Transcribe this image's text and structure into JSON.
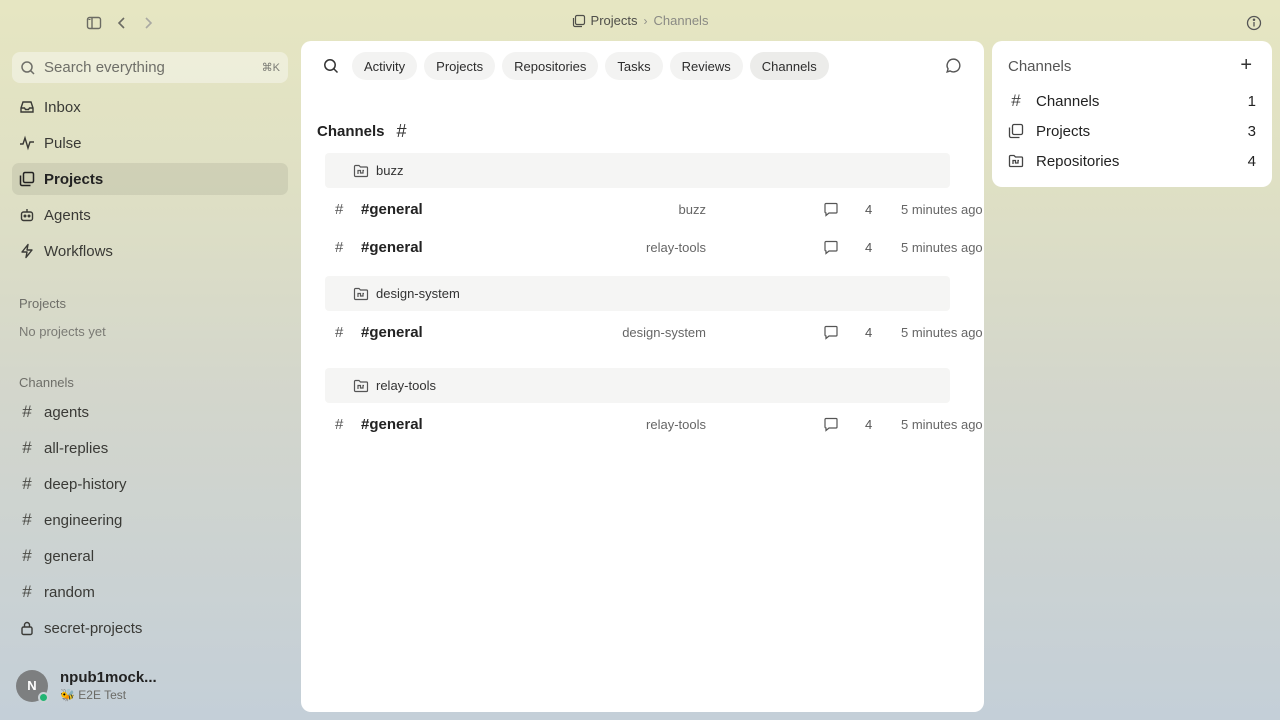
{
  "topbar": {
    "breadcrumb": [
      "Projects",
      "Channels"
    ],
    "separator": "›"
  },
  "search": {
    "placeholder": "Search everything",
    "shortcut": "⌘K"
  },
  "nav": [
    {
      "label": "Inbox",
      "icon": "inbox-icon",
      "active": false
    },
    {
      "label": "Pulse",
      "icon": "pulse-icon",
      "active": false
    },
    {
      "label": "Projects",
      "icon": "projects-icon",
      "active": true
    },
    {
      "label": "Agents",
      "icon": "agents-icon",
      "active": false
    },
    {
      "label": "Workflows",
      "icon": "workflows-icon",
      "active": false
    }
  ],
  "sidebar_projects": {
    "title": "Projects",
    "empty": "No projects yet"
  },
  "sidebar_channels": {
    "title": "Channels",
    "items": [
      {
        "label": "agents",
        "icon": "#"
      },
      {
        "label": "all-replies",
        "icon": "#"
      },
      {
        "label": "deep-history",
        "icon": "#"
      },
      {
        "label": "engineering",
        "icon": "#"
      },
      {
        "label": "general",
        "icon": "#"
      },
      {
        "label": "random",
        "icon": "#"
      },
      {
        "label": "secret-projects",
        "icon": "lock-icon"
      }
    ]
  },
  "user": {
    "initial": "N",
    "name": "npub1mock...",
    "subtitle": "🐝 E2E Test",
    "status_color": "#22b573"
  },
  "tabs": [
    "Activity",
    "Projects",
    "Repositories",
    "Tasks",
    "Reviews",
    "Channels"
  ],
  "active_tab": "Channels",
  "page": {
    "title": "Channels",
    "title_icon": "#"
  },
  "groups": [
    {
      "name": "buzz",
      "rows": [
        {
          "name": "#general",
          "project": "buzz",
          "messages": "4",
          "time": "5 minutes ago"
        },
        {
          "name": "#general",
          "project": "relay-tools",
          "messages": "4",
          "time": "5 minutes ago"
        }
      ]
    },
    {
      "name": "design-system",
      "rows": [
        {
          "name": "#general",
          "project": "design-system",
          "messages": "4",
          "time": "5 minutes ago"
        }
      ]
    },
    {
      "name": "relay-tools",
      "rows": [
        {
          "name": "#general",
          "project": "relay-tools",
          "messages": "4",
          "time": "5 minutes ago"
        }
      ]
    }
  ],
  "right_panel": {
    "title": "Channels",
    "add": "+",
    "items": [
      {
        "label": "Channels",
        "count": "1",
        "icon": "#"
      },
      {
        "label": "Projects",
        "count": "3",
        "icon": "projects-icon"
      },
      {
        "label": "Repositories",
        "count": "4",
        "icon": "repositories-icon"
      }
    ]
  }
}
